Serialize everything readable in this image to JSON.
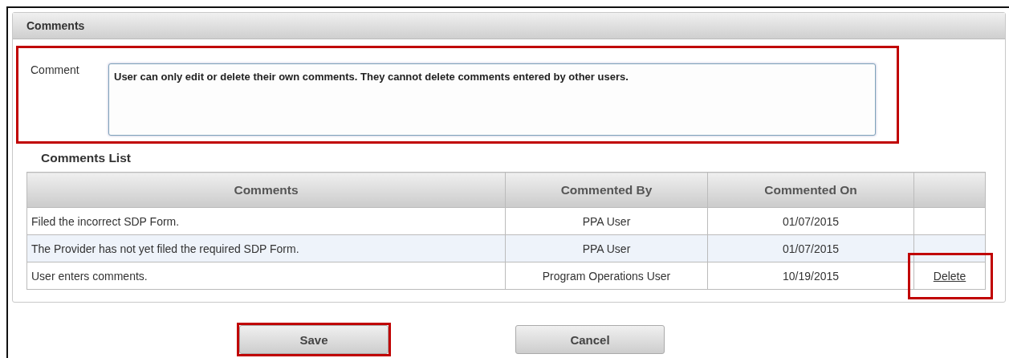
{
  "panel": {
    "title": "Comments"
  },
  "comment_field": {
    "label": "Comment",
    "value": "User can only edit or delete their own comments. They cannot delete comments entered by other users.",
    "highlighted": true
  },
  "comments_list": {
    "title": "Comments List",
    "columns": [
      "Comments",
      "Commented By",
      "Commented On"
    ],
    "rows": [
      {
        "comment": "Filed the incorrect SDP Form.",
        "by": "PPA User",
        "on": "01/07/2015"
      },
      {
        "comment": "The Provider has not yet filed the required SDP Form.",
        "by": "PPA User",
        "on": "01/07/2015"
      },
      {
        "comment": "User enters comments.",
        "by": "Program Operations User",
        "on": "10/19/2015",
        "action": {
          "label": "Delete",
          "highlighted": true
        }
      }
    ]
  },
  "buttons": [
    {
      "label": "Save",
      "highlighted": true
    },
    {
      "label": "Cancel",
      "highlighted": false
    }
  ]
}
